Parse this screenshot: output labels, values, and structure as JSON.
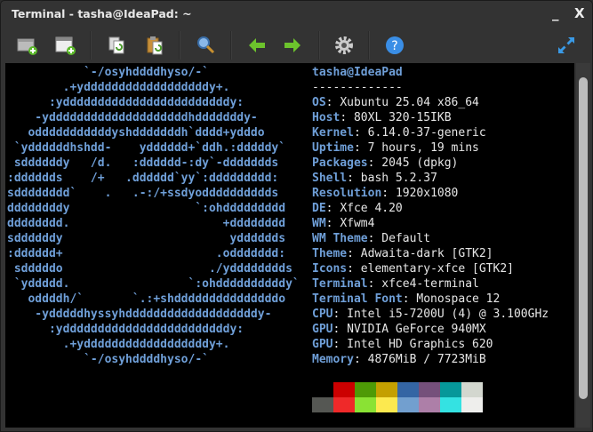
{
  "window": {
    "title": "Terminal - tasha@IdeaPad: ~",
    "minimize": "_",
    "close": "X"
  },
  "toolbar": {
    "items": [
      {
        "icon": "new-tab-icon"
      },
      {
        "icon": "new-window-icon"
      },
      {
        "icon": "copy-icon"
      },
      {
        "icon": "paste-icon"
      },
      {
        "icon": "search-icon"
      },
      {
        "icon": "previous-tab-icon"
      },
      {
        "icon": "next-tab-icon"
      },
      {
        "icon": "gear-icon"
      },
      {
        "icon": "help-icon"
      },
      {
        "icon": "fullscreen-icon"
      }
    ]
  },
  "logo": "           `-/osyhddddhyso/-`\n        .+yddddddddddddddddddy+.\n      :yddddddddddddddddddddddddy:\n    -yddddddddddddddddddddhdddddddy-\n   odddddddddddyshdddddddh`dddd+ydddo\n `yddddddhshdd-    ydddddd+`ddh.:dddddy`\n sddddddy   /d.   :dddddd-:dy`-ddddddds\n:dddddds    /+   .dddddd`yy`:ddddddddd:\nsdddddddd`    .   .-:/+ssdyodddddddddds\nddddddddy                  `:ohddddddddd\ndddddddd.                      +dddddddd\nsddddddy                        ydddddds\n:dddddd+                      .oddddddd:\n sdddddo                     ./ydddddddds\n `yddddd.                 `:ohddddddddddy`\n   oddddh/`       `.:+shdddddddddddddddo\n    -ydddddhyssyhdddddddddddddddddddy-\n      :yddddddddddddddddddddddddy:\n        .+yddddddddddddddddddy+.\n           `-/osyhddddhyso/-`",
  "info": {
    "user_host": "tasha@IdeaPad",
    "separator": "-------------",
    "rows": [
      {
        "label": "OS",
        "value": "Xubuntu 25.04 x86_64"
      },
      {
        "label": "Host",
        "value": "80XL 320-15IKB"
      },
      {
        "label": "Kernel",
        "value": "6.14.0-37-generic"
      },
      {
        "label": "Uptime",
        "value": "7 hours, 19 mins"
      },
      {
        "label": "Packages",
        "value": "2045 (dpkg)"
      },
      {
        "label": "Shell",
        "value": "bash 5.2.37"
      },
      {
        "label": "Resolution",
        "value": "1920x1080"
      },
      {
        "label": "DE",
        "value": "Xfce 4.20"
      },
      {
        "label": "WM",
        "value": "Xfwm4"
      },
      {
        "label": "WM Theme",
        "value": "Default"
      },
      {
        "label": "Theme",
        "value": "Adwaita-dark [GTK2]"
      },
      {
        "label": "Icons",
        "value": "elementary-xfce [GTK2]"
      },
      {
        "label": "Terminal",
        "value": "xfce4-terminal"
      },
      {
        "label": "Terminal Font",
        "value": "Monospace 12"
      },
      {
        "label": "CPU",
        "value": "Intel i5-7200U (4) @ 3.100GHz"
      },
      {
        "label": "GPU",
        "value": "NVIDIA GeForce 940MX"
      },
      {
        "label": "GPU",
        "value": "Intel HD Graphics 620"
      },
      {
        "label": "Memory",
        "value": "4876MiB / 7723MiB"
      }
    ]
  },
  "palette": {
    "normal": [
      "#000000",
      "#cc0000",
      "#4e9a06",
      "#c4a000",
      "#3465a4",
      "#75507b",
      "#06989a",
      "#d3d7cf"
    ],
    "bright": [
      "#555753",
      "#ef2929",
      "#8ae234",
      "#fce94f",
      "#729fcf",
      "#ad7fa8",
      "#34e2e2",
      "#eeeeec"
    ]
  }
}
